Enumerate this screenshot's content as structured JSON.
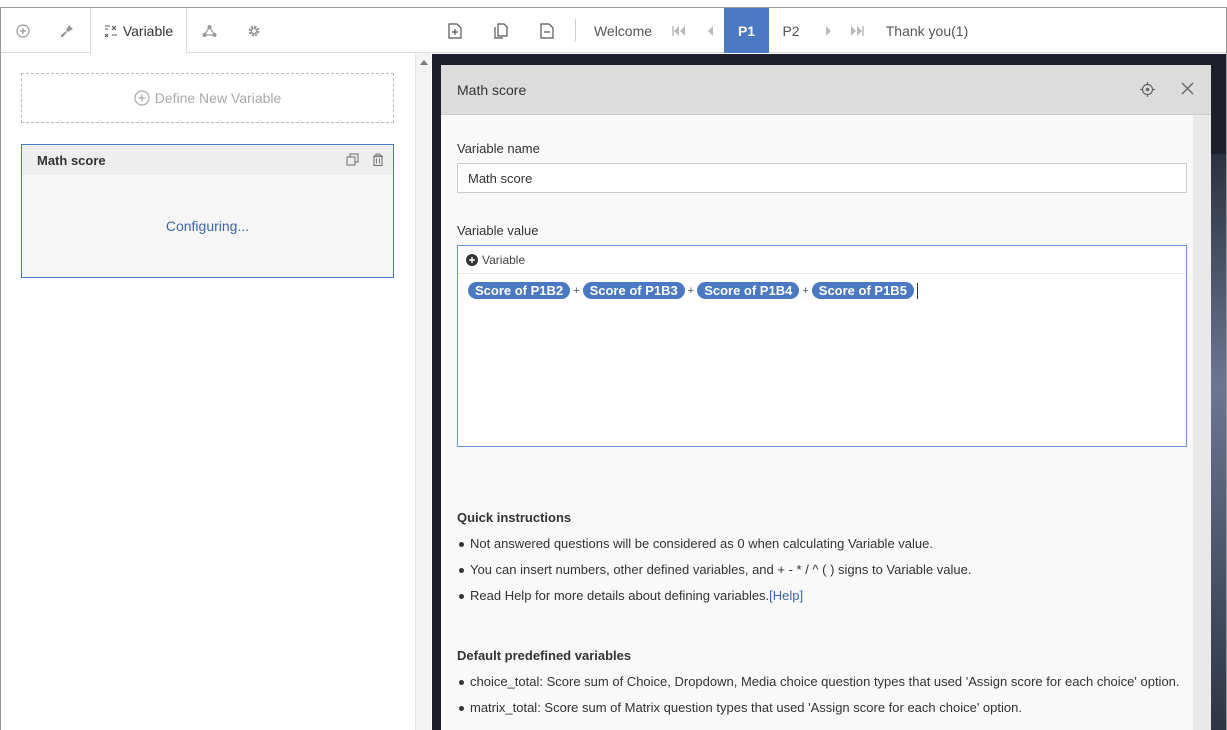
{
  "left_tabs": {
    "variable_label": "Variable"
  },
  "define_button": {
    "label": "Define New Variable"
  },
  "variable_card": {
    "title": "Math score",
    "status": "Configuring..."
  },
  "toolbar": {
    "pages": [
      "Welcome",
      "P1",
      "P2",
      "Thank you(1)"
    ],
    "active_page": "P1"
  },
  "modal": {
    "title": "Math score",
    "name_label": "Variable name",
    "name_value": "Math score",
    "value_label": "Variable value",
    "insert_variable_label": "Variable",
    "expression": {
      "terms": [
        "Score of P1B2",
        "Score of P1B3",
        "Score of P1B4",
        "Score of P1B5"
      ],
      "operators": [
        "+",
        "+",
        "+"
      ]
    },
    "quick_instructions": {
      "title": "Quick instructions",
      "items": [
        "Not answered questions will be considered as 0 when calculating Variable value.",
        "You can insert numbers, other defined variables, and + - * / ^ ( ) signs to Variable value.",
        "Read Help for more details about defining variables."
      ],
      "help_link": "[Help]"
    },
    "predefined": {
      "title": "Default predefined variables",
      "items": [
        "choice_total: Score sum of Choice, Dropdown, Media choice question types that used 'Assign score for each choice' option.",
        "matrix_total: Score sum of Matrix question types that used 'Assign score for each choice' option."
      ]
    }
  },
  "colors": {
    "accent": "#4a78c2",
    "canvas_bg": "#1d1f2a",
    "modal_header": "#dcdcdc"
  }
}
